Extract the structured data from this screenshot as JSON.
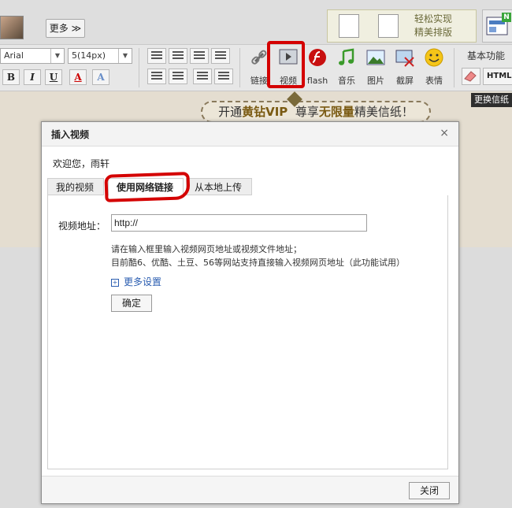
{
  "topbar": {
    "more_label": "更多 ≫",
    "promo_text_line1": "轻松实现",
    "promo_text_line2": "精美排版"
  },
  "toolbar": {
    "font_family": "Arial",
    "font_size": "5(14px)",
    "bold": "B",
    "italic": "I",
    "underline": "U",
    "font_color": "A",
    "highlight": "A",
    "tools": [
      {
        "name": "link",
        "label": "链接",
        "icon": "link-icon"
      },
      {
        "name": "video",
        "label": "视频",
        "icon": "video-icon"
      },
      {
        "name": "flash",
        "label": "flash",
        "icon": "flash-icon"
      },
      {
        "name": "music",
        "label": "音乐",
        "icon": "music-icon"
      },
      {
        "name": "image",
        "label": "图片",
        "icon": "image-icon"
      },
      {
        "name": "screenshot",
        "label": "截屏",
        "icon": "screenshot-icon"
      },
      {
        "name": "emoji",
        "label": "表情",
        "icon": "smiley-icon"
      }
    ],
    "basic_func": "基本功能",
    "html_label": "HTML",
    "change_tip": "更换信纸"
  },
  "banner": {
    "part1": "开通",
    "part2": "黄钻VIP",
    "part3": "尊享",
    "part4": "无限量",
    "part5": "精美信纸！"
  },
  "dialog": {
    "title": "插入视频",
    "close_symbol": "×",
    "welcome": "欢迎您，雨轩",
    "tabs": [
      "我的视频",
      "使用网络链接",
      "从本地上传"
    ],
    "url_label": "视频地址：",
    "url_value": "http://",
    "hint_line1": "请在输入框里输入视频网页地址或视频文件地址；",
    "hint_line2": "目前酷6、优酷、土豆、56等网站支持直接输入视频网页地址（此功能试用）",
    "more_settings": "更多设置",
    "plus_symbol": "+",
    "ok_label": "确定",
    "close_label": "关闭"
  },
  "colors": {
    "highlight_red": "#d40000",
    "link_blue": "#2a5db0"
  }
}
